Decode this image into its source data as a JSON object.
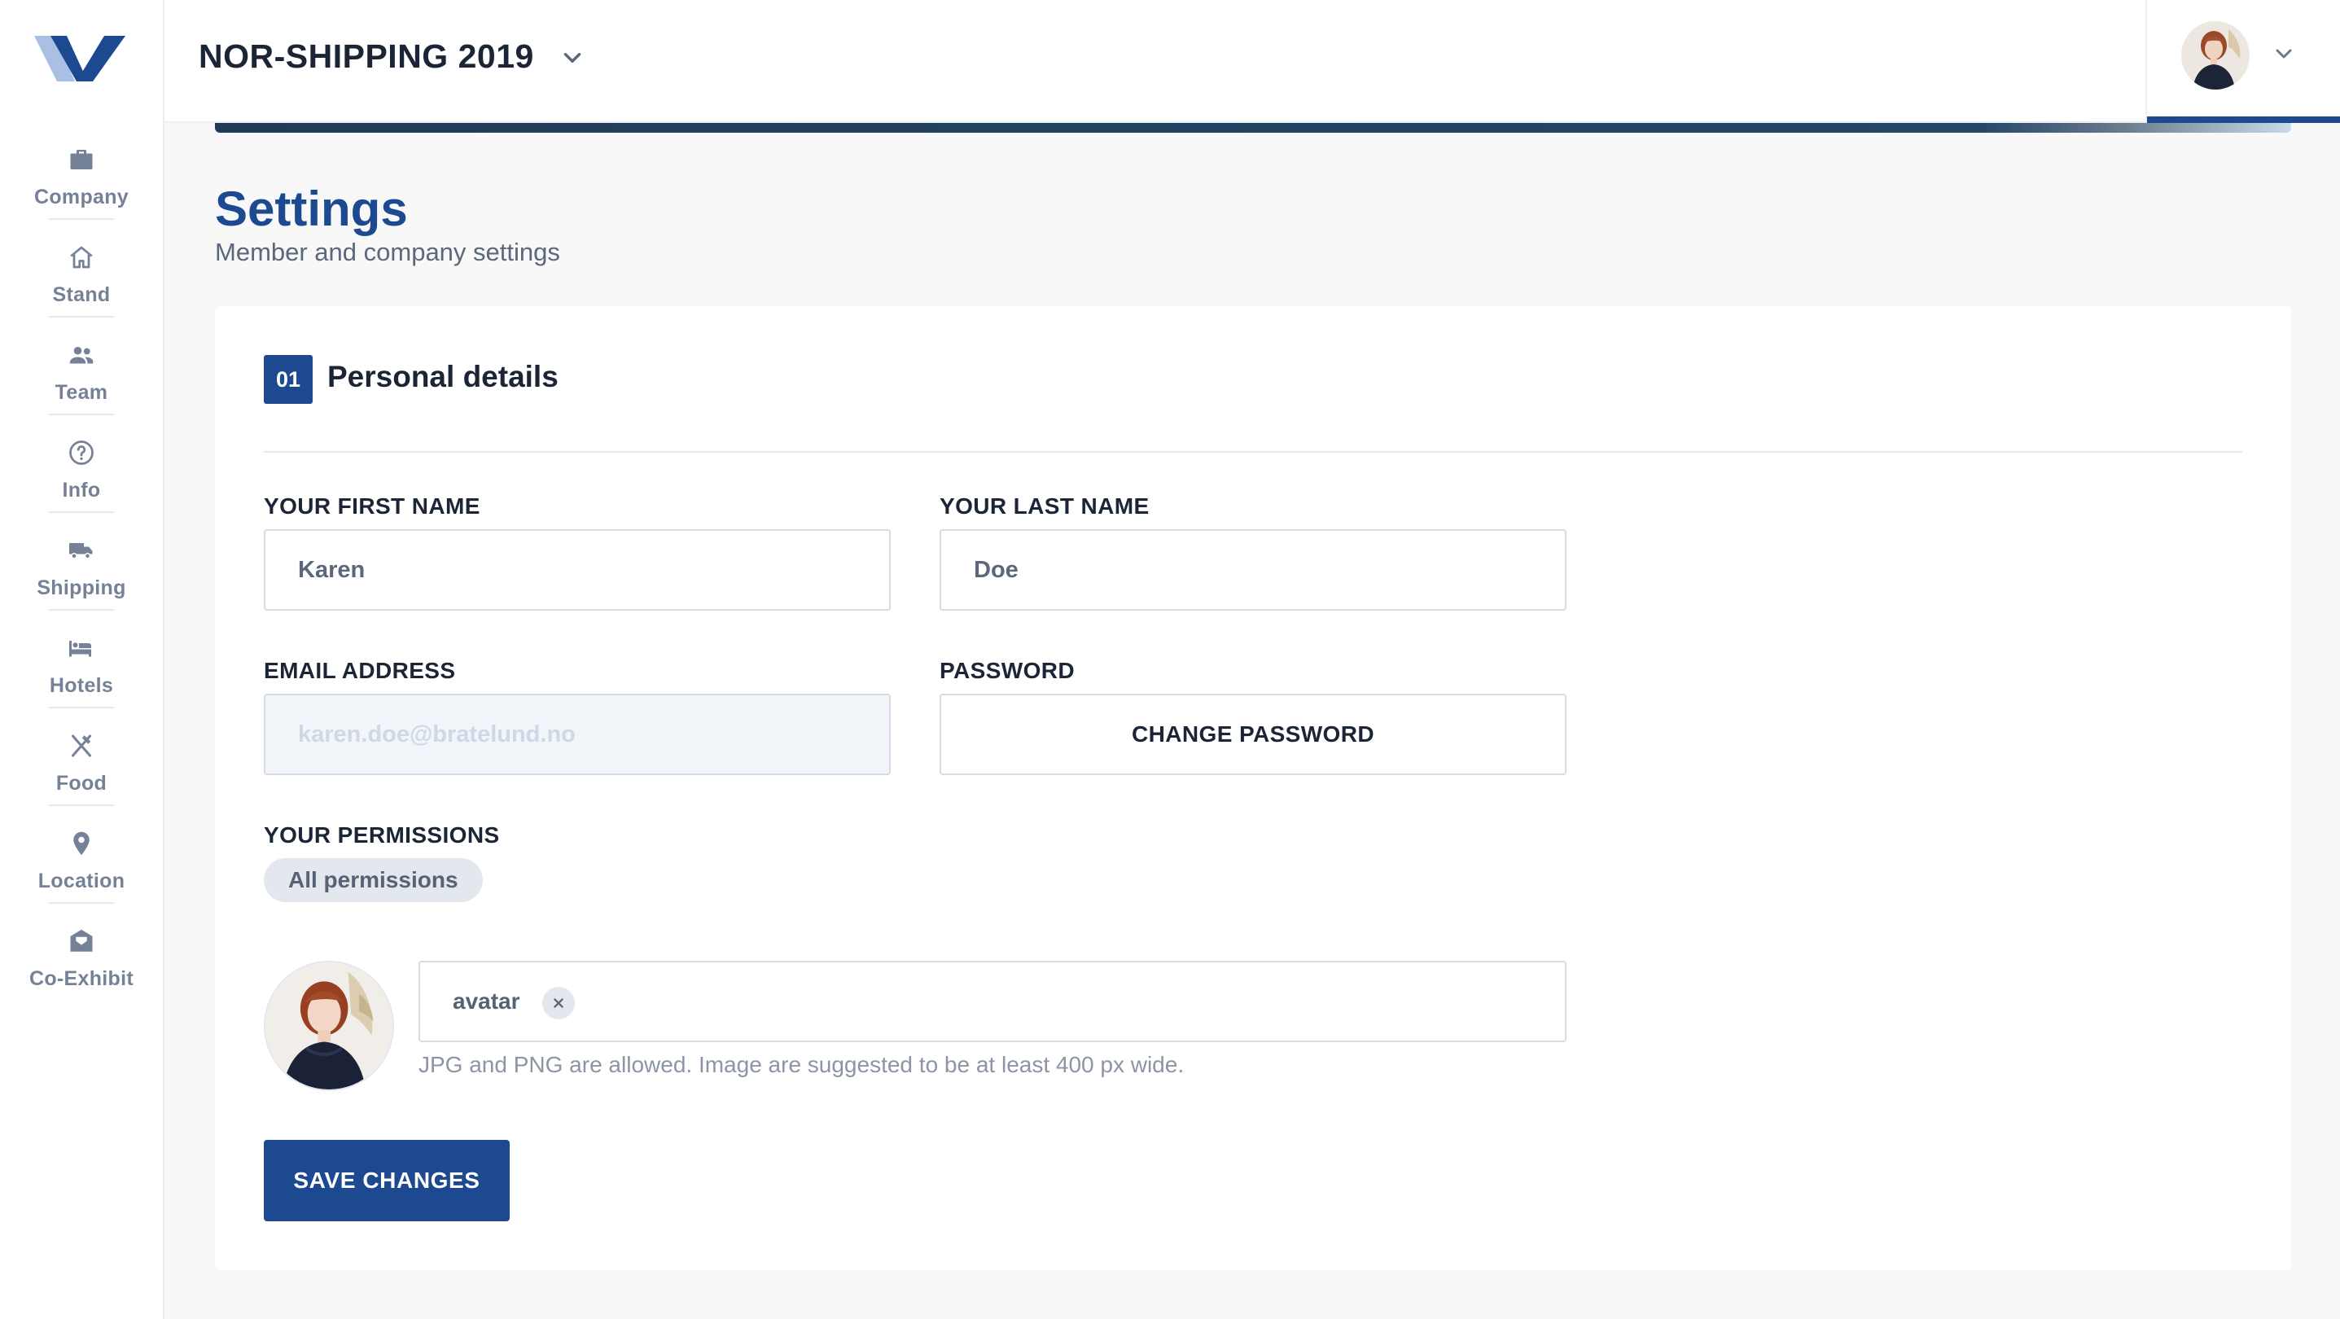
{
  "sidebar": {
    "items": [
      {
        "label": "Company",
        "icon": "briefcase-icon"
      },
      {
        "label": "Stand",
        "icon": "home-icon"
      },
      {
        "label": "Team",
        "icon": "people-icon"
      },
      {
        "label": "Info",
        "icon": "help-circle-icon"
      },
      {
        "label": "Shipping",
        "icon": "truck-icon"
      },
      {
        "label": "Hotels",
        "icon": "bed-icon"
      },
      {
        "label": "Food",
        "icon": "utensils-icon"
      },
      {
        "label": "Location",
        "icon": "map-pin-icon"
      },
      {
        "label": "Co-Exhibit",
        "icon": "open-envelope-icon"
      }
    ]
  },
  "header": {
    "event_title": "NOR-SHIPPING 2019"
  },
  "page": {
    "title": "Settings",
    "subtitle": "Member and company settings"
  },
  "section": {
    "number": "01",
    "title": "Personal details"
  },
  "form": {
    "first_name_label": "YOUR FIRST NAME",
    "first_name_value": "Karen",
    "last_name_label": "YOUR LAST NAME",
    "last_name_value": "Doe",
    "email_label": "EMAIL ADDRESS",
    "email_value": "karen.doe@bratelund.no",
    "password_label": "PASSWORD",
    "change_password_label": "CHANGE PASSWORD",
    "permissions_label": "YOUR PERMISSIONS",
    "permissions_value": "All permissions",
    "avatar_file": "avatar",
    "avatar_help": "JPG and PNG are allowed. Image are suggested to be at least 400 px wide.",
    "save_label": "SAVE CHANGES"
  },
  "colors": {
    "primary": "#1d4990",
    "sidebar_label": "#758196",
    "text_dark": "#1b2535"
  }
}
